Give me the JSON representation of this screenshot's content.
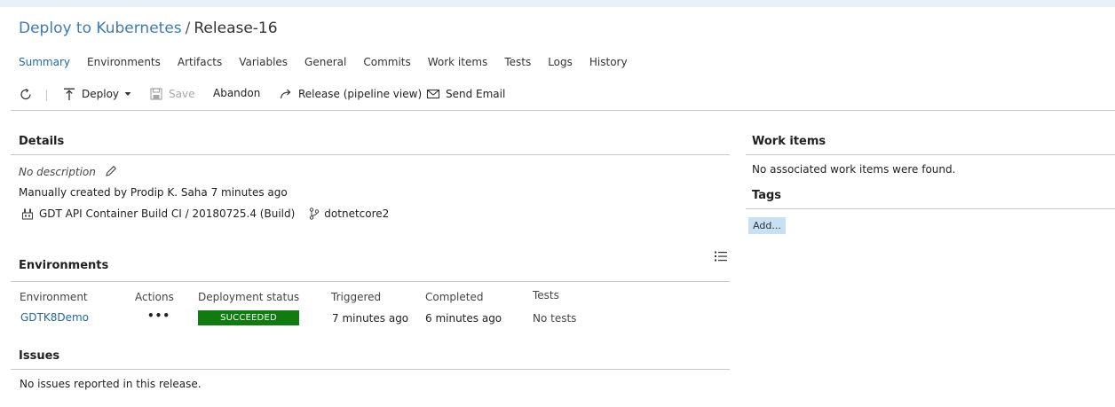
{
  "breadcrumb": {
    "pipeline": "Deploy to Kubernetes",
    "separator": "/",
    "release": "Release-16"
  },
  "tabs": [
    "Summary",
    "Environments",
    "Artifacts",
    "Variables",
    "General",
    "Commits",
    "Work items",
    "Tests",
    "Logs",
    "History"
  ],
  "toolbar": {
    "deploy_label": "Deploy",
    "save_label": "Save",
    "abandon_label": "Abandon",
    "pipeline_view_label": "Release (pipeline view)",
    "send_email_label": "Send Email"
  },
  "details": {
    "title": "Details",
    "description": "No description",
    "created": "Manually created by Prodip K. Saha 7 minutes ago",
    "artifact": "GDT API Container Build CI / 20180725.4 (Build)",
    "branch": "dotnetcore2"
  },
  "environments": {
    "title": "Environments",
    "columns": {
      "environment": "Environment",
      "actions": "Actions",
      "status": "Deployment status",
      "triggered": "Triggered",
      "completed": "Completed",
      "tests": "Tests"
    },
    "rows": [
      {
        "name": "GDTK8Demo",
        "actions": "•••",
        "status": "SUCCEEDED",
        "triggered": "7 minutes ago",
        "completed": "6 minutes ago",
        "tests": "No tests"
      }
    ]
  },
  "issues": {
    "title": "Issues",
    "message": "No issues reported in this release."
  },
  "work_items": {
    "title": "Work items",
    "message": "No associated work items were found."
  },
  "tags": {
    "title": "Tags",
    "add_label": "Add..."
  },
  "colors": {
    "accent": "#2466a8",
    "success": "#107c10",
    "tag_button": "#c7e0f4"
  }
}
